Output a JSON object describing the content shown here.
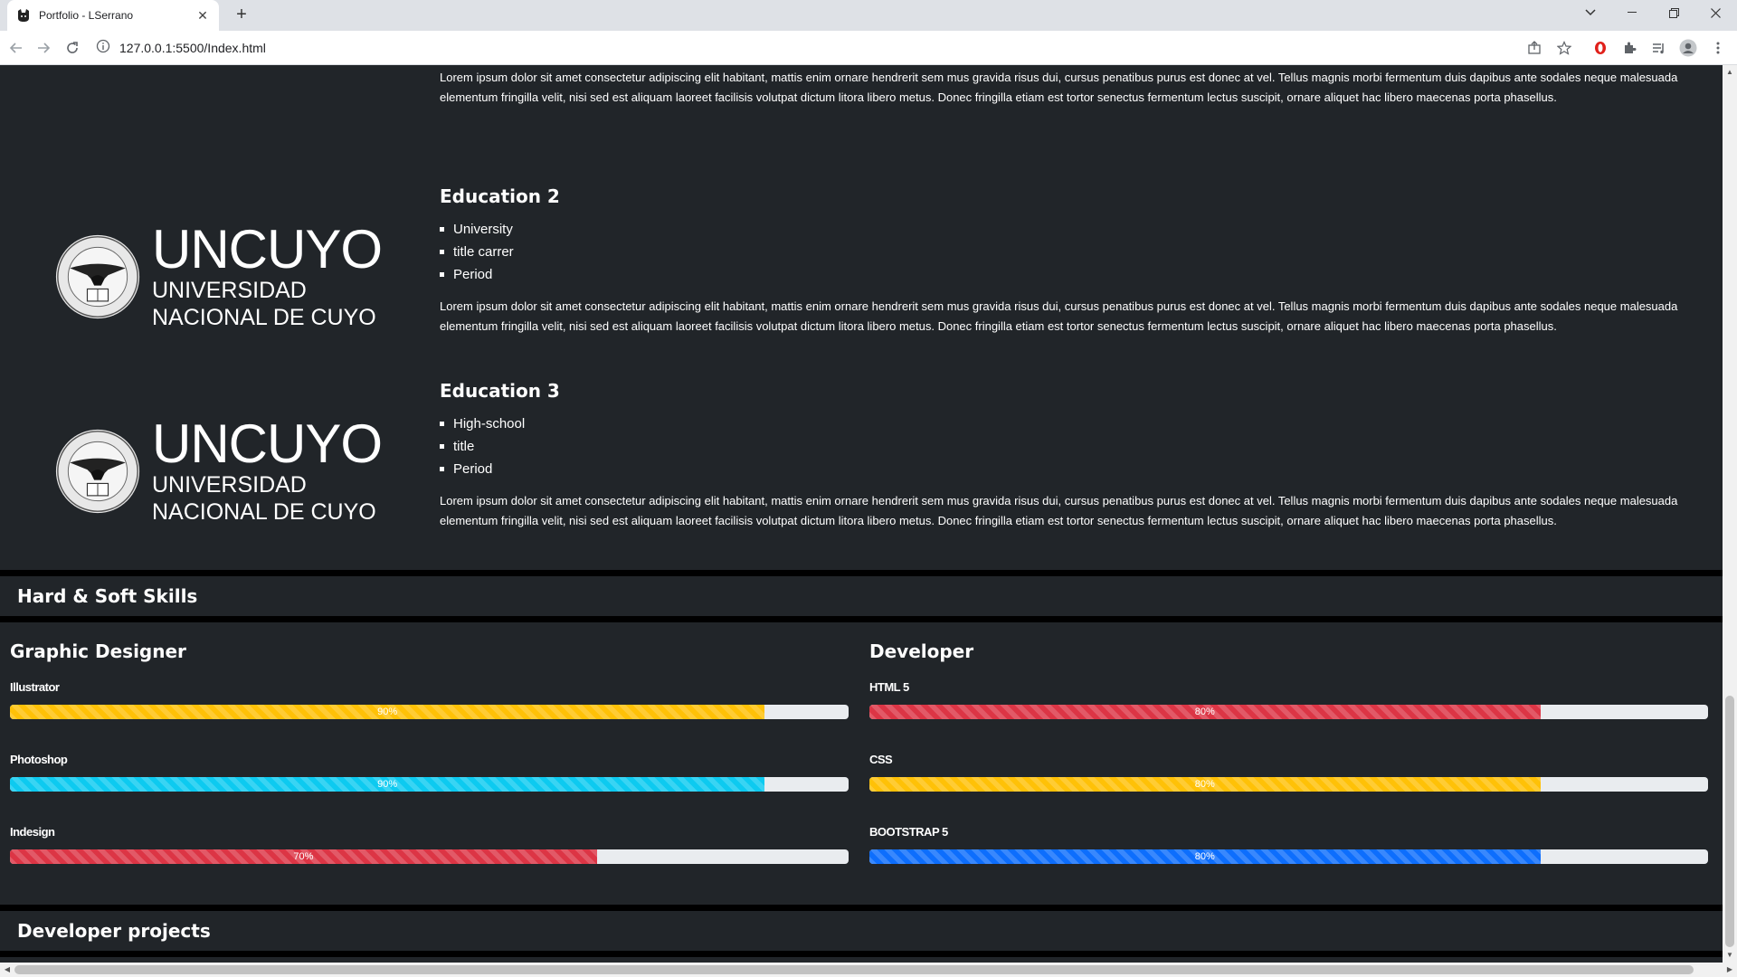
{
  "browser": {
    "tab_title": "Portfolio - LSerrano",
    "url": "127.0.0.1:5500/Index.html"
  },
  "education": {
    "prev_lorem": "Lorem ipsum dolor sit amet consectetur adipiscing elit habitant, mattis enim ornare hendrerit sem mus gravida risus dui, cursus penatibus purus est donec at vel. Tellus magnis morbi fermentum duis dapibus ante sodales neque malesuada elementum fringilla velit, nisi sed est aliquam laoreet facilisis volutpat dictum litora libero metus. Donec fringilla etiam est tortor senectus fermentum lectus suscipit, ornare aliquet hac libero maecenas porta phasellus.",
    "items": [
      {
        "title": "Education 2",
        "list": [
          "University",
          "title carrer",
          "Period"
        ],
        "text": "Lorem ipsum dolor sit amet consectetur adipiscing elit habitant, mattis enim ornare hendrerit sem mus gravida risus dui, cursus penatibus purus est donec at vel. Tellus magnis morbi fermentum duis dapibus ante sodales neque malesuada elementum fringilla velit, nisi sed est aliquam laoreet facilisis volutpat dictum litora libero metus. Donec fringilla etiam est tortor senectus fermentum lectus suscipit, ornare aliquet hac libero maecenas porta phasellus.",
        "logo": {
          "main": "UNCUYO",
          "line1": "UNIVERSIDAD",
          "line2": "NACIONAL DE CUYO"
        }
      },
      {
        "title": "Education 3",
        "list": [
          "High-school",
          "title",
          "Period"
        ],
        "text": "Lorem ipsum dolor sit amet consectetur adipiscing elit habitant, mattis enim ornare hendrerit sem mus gravida risus dui, cursus penatibus purus est donec at vel. Tellus magnis morbi fermentum duis dapibus ante sodales neque malesuada elementum fringilla velit, nisi sed est aliquam laoreet facilisis volutpat dictum litora libero metus. Donec fringilla etiam est tortor senectus fermentum lectus suscipit, ornare aliquet hac libero maecenas porta phasellus.",
        "logo": {
          "main": "UNCUYO",
          "line1": "UNIVERSIDAD",
          "line2": "NACIONAL DE CUYO"
        }
      }
    ]
  },
  "skills": {
    "section_title": "Hard & Soft Skills",
    "columns": [
      {
        "title": "Graphic Designer",
        "items": [
          {
            "name": "Illustrator",
            "percent": 90,
            "label": "90%",
            "color": "#ffc107"
          },
          {
            "name": "Photoshop",
            "percent": 90,
            "label": "90%",
            "color": "#0dcaf0"
          },
          {
            "name": "Indesign",
            "percent": 70,
            "label": "70%",
            "color": "#dc3545"
          }
        ]
      },
      {
        "title": "Developer",
        "items": [
          {
            "name": "HTML 5",
            "percent": 80,
            "label": "80%",
            "color": "#dc3545"
          },
          {
            "name": "CSS",
            "percent": 80,
            "label": "80%",
            "color": "#ffc107"
          },
          {
            "name": "BOOTSTRAP 5",
            "percent": 80,
            "label": "80%",
            "color": "#0d6efd"
          }
        ]
      }
    ]
  },
  "projects": {
    "section_title": "Developer projects"
  }
}
